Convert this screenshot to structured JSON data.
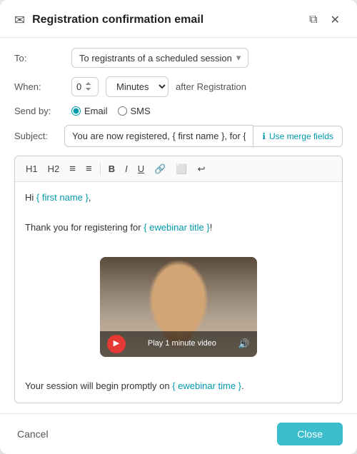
{
  "modal": {
    "title": "Registration confirmation email",
    "header_icon": "✉",
    "copy_icon": "⧉",
    "close_x": "✕"
  },
  "form": {
    "to_label": "To:",
    "to_value": "To registrants of a scheduled session",
    "when_label": "When:",
    "when_number": "0",
    "when_unit": "Minutes",
    "after_text": "after Registration",
    "send_by_label": "Send by:",
    "send_by_options": [
      "Email",
      "SMS"
    ],
    "send_by_selected": "Email",
    "subject_label": "Subject:",
    "subject_value": "You are now registered, { first name }, for { ewebinar title }",
    "merge_fields_label": "Use merge fields"
  },
  "toolbar": {
    "buttons": [
      "H1",
      "H2",
      "≡",
      "≡",
      "B",
      "I",
      "U",
      "🔗",
      "⬜",
      "↩"
    ]
  },
  "editor": {
    "greeting": "Hi { first name },",
    "body": "Thank you for registering for { ewebinar title }!",
    "session_text": "Your session will begin promptly on { ewebinar time }."
  },
  "video": {
    "play_label": "Play 1 minute video"
  },
  "footer": {
    "cancel_label": "Cancel",
    "close_label": "Close"
  }
}
